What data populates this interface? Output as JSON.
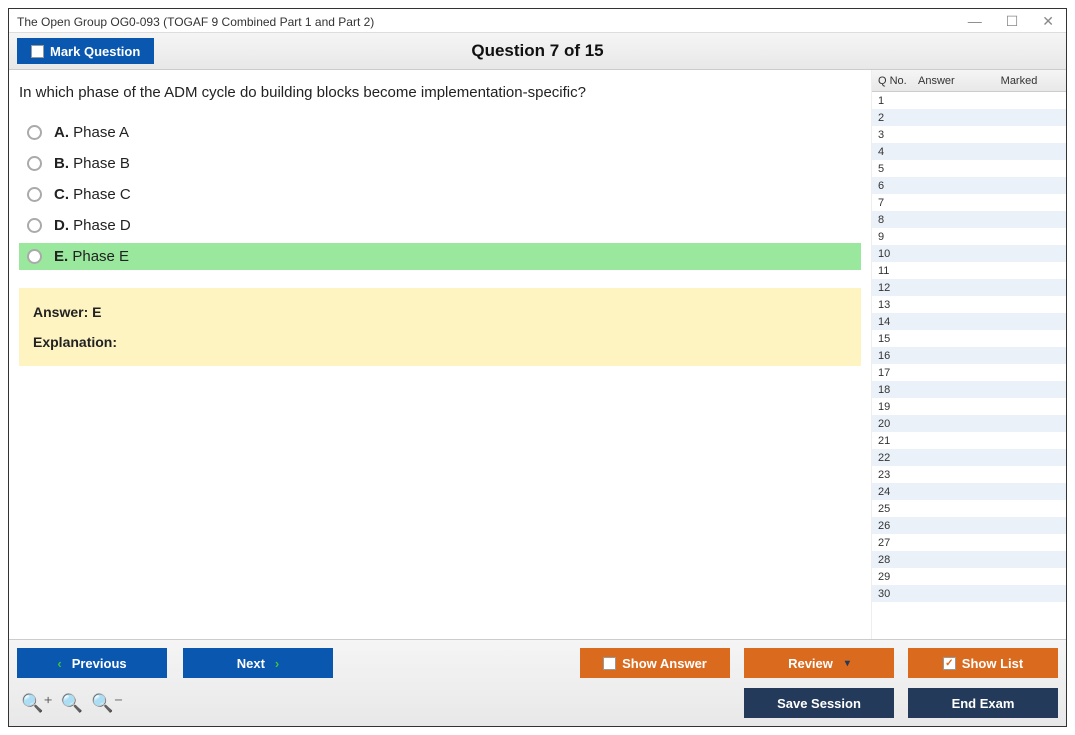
{
  "window": {
    "title": "The Open Group OG0-093 (TOGAF 9 Combined Part 1 and Part 2)"
  },
  "toolbar": {
    "mark_label": "Mark Question",
    "question_header": "Question 7 of 15"
  },
  "question": {
    "text": "In which phase of the ADM cycle do building blocks become implementation-specific?",
    "options": [
      {
        "letter": "A.",
        "text": "Phase A",
        "highlight": false
      },
      {
        "letter": "B.",
        "text": "Phase B",
        "highlight": false
      },
      {
        "letter": "C.",
        "text": "Phase C",
        "highlight": false
      },
      {
        "letter": "D.",
        "text": "Phase D",
        "highlight": false
      },
      {
        "letter": "E.",
        "text": "Phase E",
        "highlight": true
      }
    ],
    "answer_label": "Answer:",
    "answer_value": "E",
    "explanation_label": "Explanation:",
    "explanation_text": ""
  },
  "sidebar": {
    "headers": {
      "qno": "Q No.",
      "answer": "Answer",
      "marked": "Marked"
    },
    "rows_count": 30
  },
  "footer": {
    "previous": "Previous",
    "next": "Next",
    "show_answer": "Show Answer",
    "review": "Review",
    "show_list": "Show List",
    "save_session": "Save Session",
    "end_exam": "End Exam"
  }
}
